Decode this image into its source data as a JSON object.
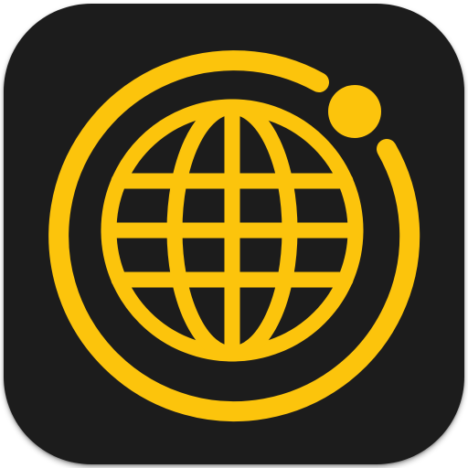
{
  "icon": {
    "name": "globe-orbit-app-icon",
    "glyph": "globe-icon",
    "orbit": "orbit-ring-icon",
    "satellite": "satellite-dot-icon"
  },
  "colors": {
    "background": "#1c1c1c",
    "accent": "#fcc40c"
  }
}
